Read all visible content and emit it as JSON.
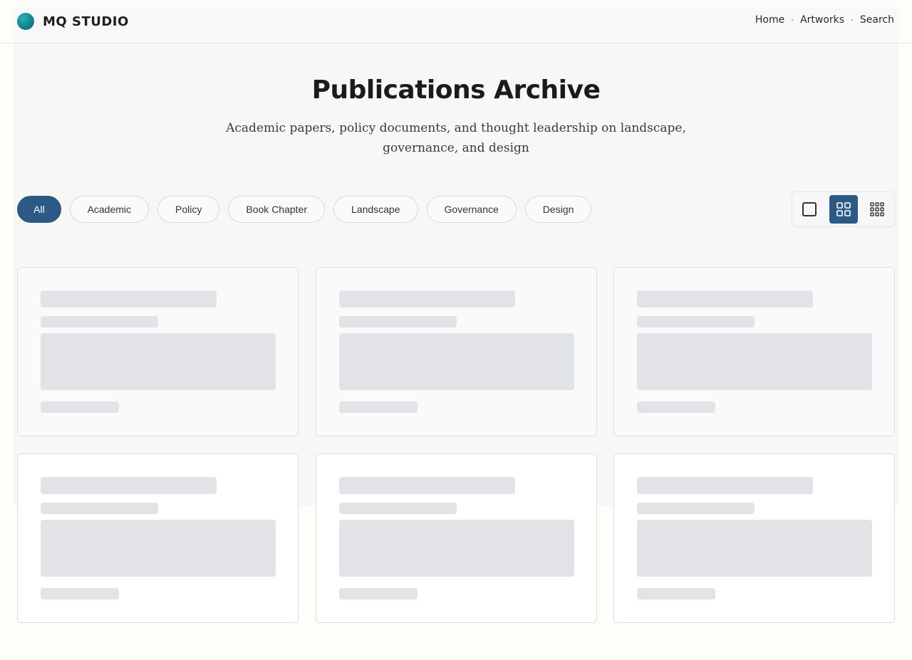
{
  "brand": {
    "name": "MQ STUDIO",
    "logo_icon": "studio-logo-icon"
  },
  "nav": {
    "items": [
      {
        "label": "Home"
      },
      {
        "label": "Artworks"
      },
      {
        "label": "Search"
      }
    ],
    "separator": "·"
  },
  "hero": {
    "title": "Publications Archive",
    "subtitle": "Academic papers, policy documents, and thought leadership on landscape, governance, and design"
  },
  "filters": {
    "items": [
      {
        "label": "All",
        "active": true
      },
      {
        "label": "Academic",
        "active": false
      },
      {
        "label": "Policy",
        "active": false
      },
      {
        "label": "Book Chapter",
        "active": false
      },
      {
        "label": "Landscape",
        "active": false
      },
      {
        "label": "Governance",
        "active": false
      },
      {
        "label": "Design",
        "active": false
      }
    ]
  },
  "view_modes": {
    "options": [
      {
        "icon": "single-view-icon",
        "active": false
      },
      {
        "icon": "grid-2x2-view-icon",
        "active": true
      },
      {
        "icon": "grid-3x3-view-icon",
        "active": false
      }
    ]
  },
  "cards": {
    "state": "loading",
    "count": 6
  },
  "colors": {
    "accent": "#2c5985",
    "skeleton": "#e2e3e6",
    "border": "#dedede",
    "logo_teal": "#178a9a"
  }
}
